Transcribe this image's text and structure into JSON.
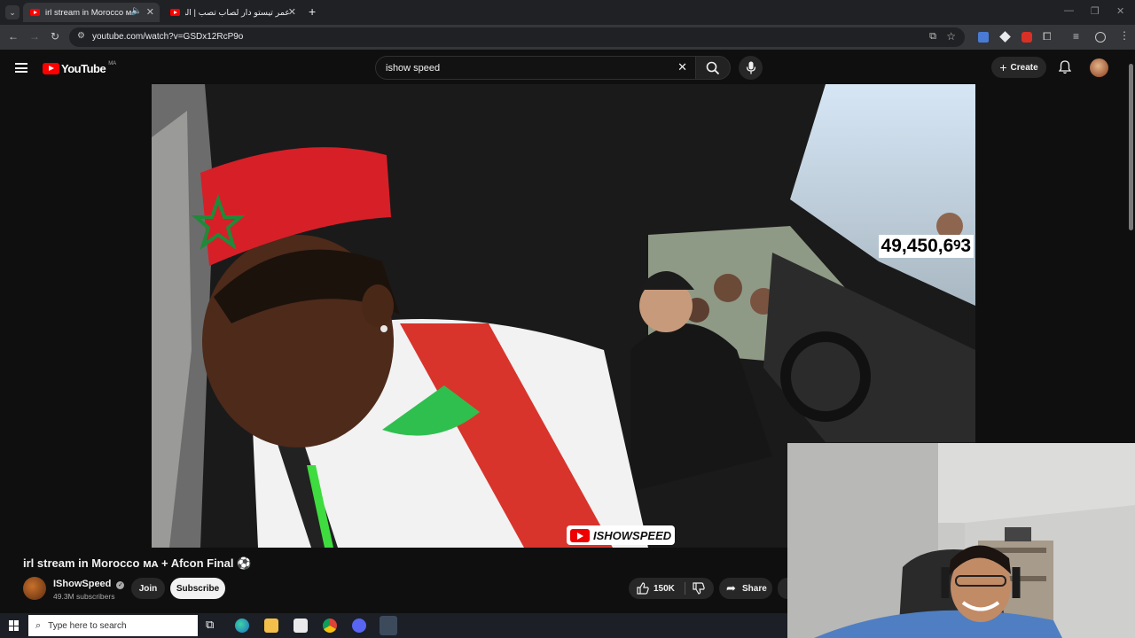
{
  "browser": {
    "tabs": [
      {
        "title": "irl stream in Morocco ᴍᴀ -",
        "active": true
      },
      {
        "title": "عمر تيستو دار لصاب تصب | البرو",
        "active": false
      }
    ],
    "new_tab": "+",
    "url": "youtube.com/watch?v=GSDx12RcP9o"
  },
  "youtube": {
    "logo_text": "YouTube",
    "country_code": "MA",
    "search_value": "ishow speed",
    "create_label": "Create"
  },
  "video": {
    "view_counter": "49,450,6ꝰ3",
    "watermark": "ISHOWSPEED",
    "title": "irl stream in Morocco ᴍᴀ + Afcon Final ⚽",
    "channel": "IShowSpeed",
    "subscribers": "49.3M subscribers",
    "join_label": "Join",
    "subscribe_label": "Subscribe",
    "likes": "150K",
    "share_label": "Share"
  },
  "taskbar": {
    "search_placeholder": "Type here to search"
  },
  "colors": {
    "youtube_red": "#ff0000",
    "background": "#0f0f0f",
    "chip": "#272727"
  }
}
